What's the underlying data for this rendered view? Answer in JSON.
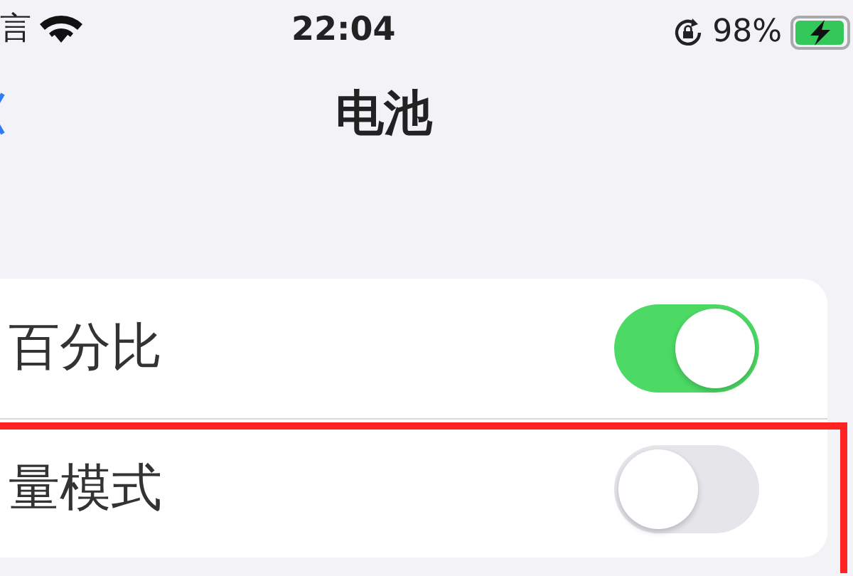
{
  "status_bar": {
    "carrier": "言",
    "time": "22:04",
    "battery_percent": "98%",
    "charging": true
  },
  "nav": {
    "title": "电池"
  },
  "rows": [
    {
      "label": "百分比",
      "on": true,
      "highlighted": false
    },
    {
      "label": "量模式",
      "on": false,
      "highlighted": true
    }
  ]
}
